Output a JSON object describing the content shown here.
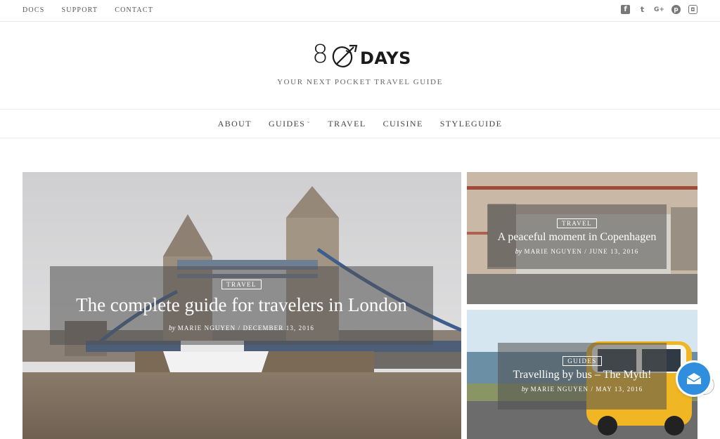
{
  "topbar": {
    "links": [
      "DOCS",
      "SUPPORT",
      "CONTACT"
    ],
    "social_icons": [
      {
        "name": "facebook-icon",
        "glyph": "f"
      },
      {
        "name": "twitter-icon",
        "glyph": "t"
      },
      {
        "name": "google-plus-icon",
        "glyph": "G+"
      },
      {
        "name": "pinterest-icon",
        "glyph": "p"
      },
      {
        "name": "instagram-icon",
        "glyph": "◘"
      }
    ]
  },
  "brand": {
    "logo_number": "8",
    "logo_word": "DAYS",
    "tagline": "YOUR NEXT POCKET TRAVEL GUIDE"
  },
  "nav": {
    "items": [
      "ABOUT",
      "GUIDES",
      "TRAVEL",
      "CUISINE",
      "STYLEGUIDE"
    ],
    "dropdown_caret": "⌄"
  },
  "featured": [
    {
      "category": "TRAVEL",
      "title": "The complete guide for travelers in London",
      "by": "by",
      "author": "MARIE NGUYEN",
      "separator": "/",
      "date": "DECEMBER 13, 2016"
    },
    {
      "category": "TRAVEL",
      "title": "A peaceful moment in Copenhagen",
      "by": "by",
      "author": "MARIE NGUYEN",
      "separator": "/",
      "date": "JUNE 13, 2016"
    },
    {
      "category": "GUIDES",
      "title": "Travelling by bus – The Myth!",
      "by": "by",
      "author": "MARIE NGUYEN",
      "separator": "/",
      "date": "MAY 13, 2016"
    }
  ],
  "colors": {
    "accent": "#2f8fde",
    "text_dark": "#1a1a1a",
    "overlay": "rgba(80,80,80,0.55)"
  }
}
